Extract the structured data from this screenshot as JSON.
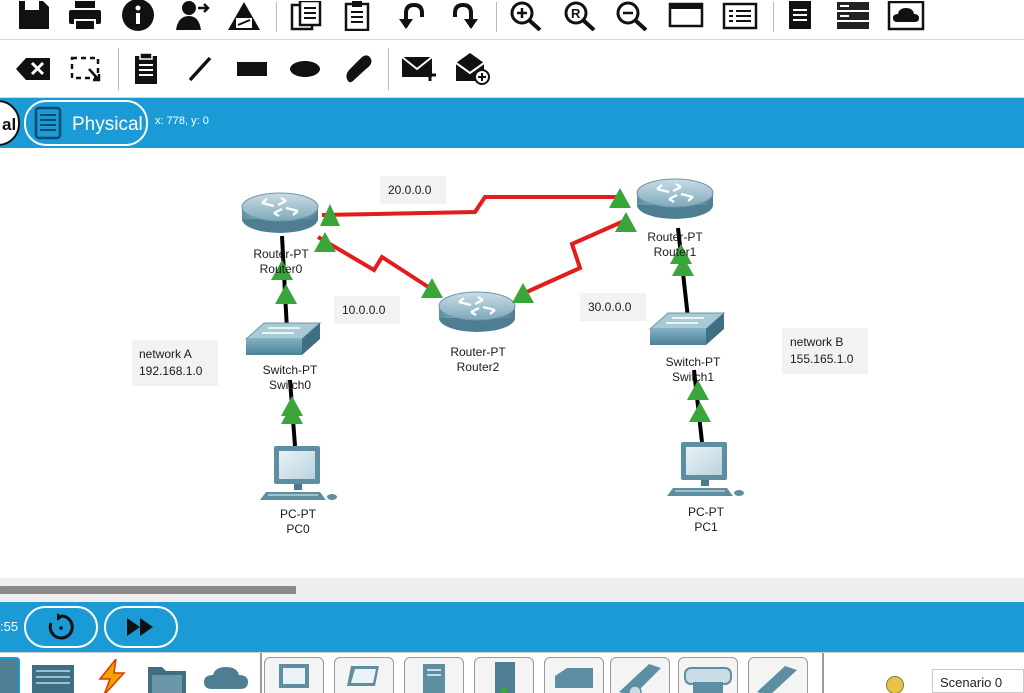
{
  "toolbar_main": {
    "icons": [
      "save-icon",
      "print-icon",
      "info-icon",
      "activity-wizard-icon",
      "custom-pdu-icon",
      "copy-icon",
      "paste-icon",
      "undo-icon",
      "redo-icon",
      "zoom-in-icon",
      "zoom-reset-icon",
      "zoom-out-icon",
      "drawing-palette-icon",
      "custom-device-dialog-icon",
      "viewport-icon",
      "cluster-icon",
      "cloud-view-icon"
    ]
  },
  "toolbar_tools": {
    "icons": [
      "delete-icon",
      "resize-shape-icon",
      "place-note-icon",
      "draw-line-icon",
      "draw-rectangle-icon",
      "draw-ellipse-icon",
      "freeform-icon",
      "add-simple-pdu-icon",
      "add-complex-pdu-icon"
    ]
  },
  "modebar": {
    "logical_tab_partial": "al",
    "physical_tab": "Physical",
    "coords": "x: 778, y: 0"
  },
  "simbar": {
    "time_partial": ":55"
  },
  "topology": {
    "networks": [
      {
        "line1": "network A",
        "line2": "192.168.1.0"
      },
      {
        "line1": "network B",
        "line2": "155.165.1.0"
      }
    ],
    "links": [
      "20.0.0.0",
      "10.0.0.0",
      "30.0.0.0"
    ],
    "devices": {
      "router0": {
        "model": "Router-PT",
        "name": "Router0"
      },
      "router1": {
        "model": "Router-PT",
        "name": "Router1"
      },
      "router2": {
        "model": "Router-PT",
        "name": "Router2"
      },
      "switch0": {
        "model": "Switch-PT",
        "name": "Switch0"
      },
      "switch1": {
        "model": "Switch-PT",
        "name": "Switch1"
      },
      "pc0": {
        "model": "PC-PT",
        "name": "PC0"
      },
      "pc1": {
        "model": "PC-PT",
        "name": "PC1"
      }
    },
    "colors": {
      "serial_link": "#e31c1c",
      "ethernet_link": "#000000",
      "link_up": "#3aa63a"
    }
  },
  "palette": {
    "scenario": "Scenario 0"
  }
}
